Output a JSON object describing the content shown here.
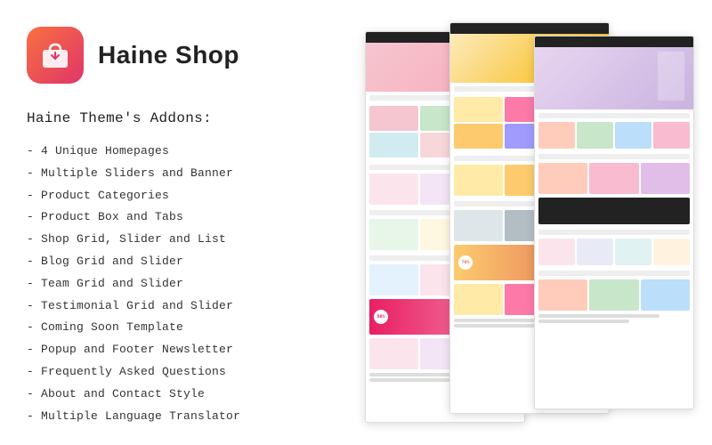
{
  "logo": {
    "text": "Haine Shop"
  },
  "addons": {
    "title": "Haine Theme's Addons:",
    "items": [
      "- 4 Unique Homepages",
      "- Multiple Sliders and Banner",
      "- Product Categories",
      "- Product Box and Tabs",
      "- Shop Grid, Slider and List",
      "- Blog Grid and Slider",
      "- Team Grid and Slider",
      "- Testimonial Grid and Slider",
      "- Coming Soon Template",
      "- Popup and Footer Newsletter",
      "- Frequently Asked Questions",
      "- About and Contact Style",
      "- Multiple Language Translator"
    ]
  }
}
